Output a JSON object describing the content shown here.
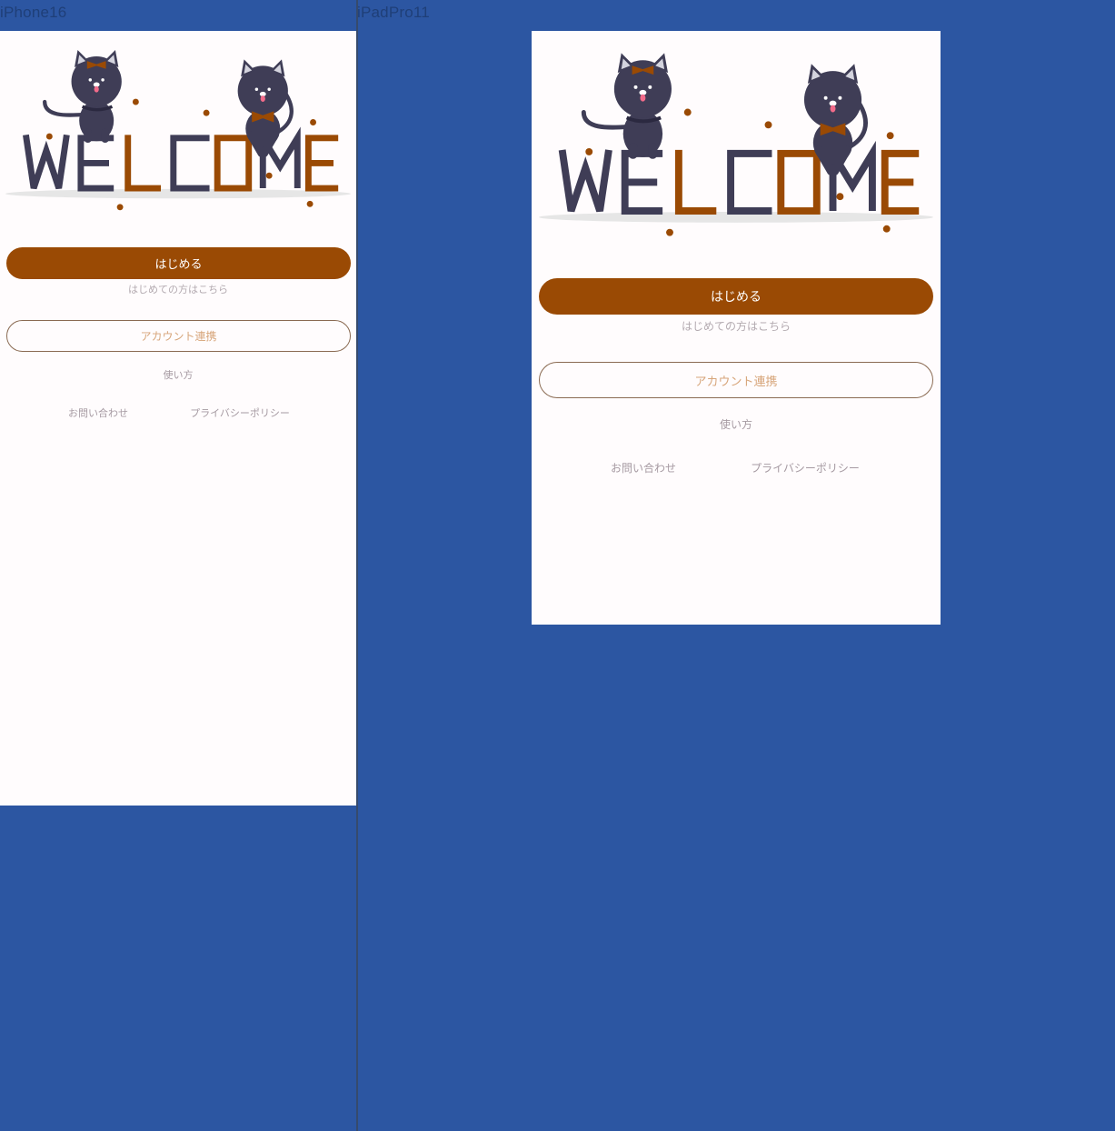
{
  "colors": {
    "canvas": "#2c56a2",
    "screen": "#fffcfd",
    "accent": "#9a4a04",
    "ink": "#3f3d56",
    "outline_text": "#d7a57a"
  },
  "frames": [
    {
      "label": "iPhone16",
      "illustration": {
        "word_letters": [
          "W",
          "E",
          "L",
          "C",
          "O",
          "M",
          "E"
        ],
        "icon": "welcome-cats-illustration"
      },
      "start_button": "はじめる",
      "start_hint": "はじめての方はこちら",
      "account_link_button": "アカウント連携",
      "how_to_use": "使い方",
      "contact": "お問い合わせ",
      "privacy_policy": "プライバシーポリシー"
    },
    {
      "label": "iPadPro11",
      "illustration": {
        "word_letters": [
          "W",
          "E",
          "L",
          "C",
          "O",
          "M",
          "E"
        ],
        "icon": "welcome-cats-illustration"
      },
      "start_button": "はじめる",
      "start_hint": "はじめての方はこちら",
      "account_link_button": "アカウント連携",
      "how_to_use": "使い方",
      "contact": "お問い合わせ",
      "privacy_policy": "プライバシーポリシー"
    }
  ]
}
